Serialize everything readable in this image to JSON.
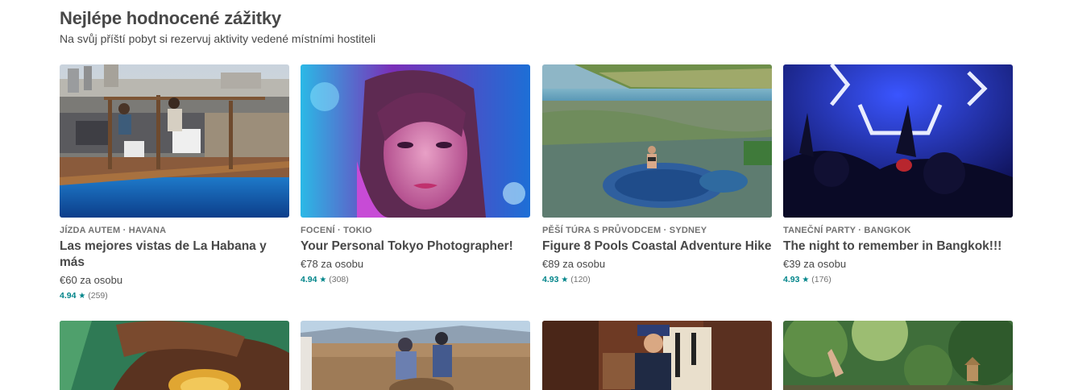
{
  "section": {
    "title": "Nejlépe hodnocené zážitky",
    "subtitle": "Na svůj příští pobyt si rezervuj aktivity vedené místními hostiteli"
  },
  "cards": [
    {
      "kicker": "JÍZDA AUTEM · HAVANA",
      "title": "Las mejores vistas de La Habana y más",
      "price": "€60 za osobu",
      "rating": "4.94",
      "star": "★",
      "reviews": "(259)"
    },
    {
      "kicker": "FOCENÍ · TOKIO",
      "title": "Your Personal Tokyo Photographer!",
      "price": "€78 za osobu",
      "rating": "4.94",
      "star": "★",
      "reviews": "(308)"
    },
    {
      "kicker": "PĚŠÍ TÚRA S PRŮVODCEM · SYDNEY",
      "title": "Figure 8 Pools Coastal Adventure Hike",
      "price": "€89 za osobu",
      "rating": "4.93",
      "star": "★",
      "reviews": "(120)"
    },
    {
      "kicker": "TANEČNÍ PARTY · BANGKOK",
      "title": "The night to remember in Bangkok!!!",
      "price": "€39 za osobu",
      "rating": "4.93",
      "star": "★",
      "reviews": "(176)"
    }
  ],
  "colors": {
    "text": "#484848",
    "muted": "#717171",
    "rating_accent": "#008489"
  }
}
